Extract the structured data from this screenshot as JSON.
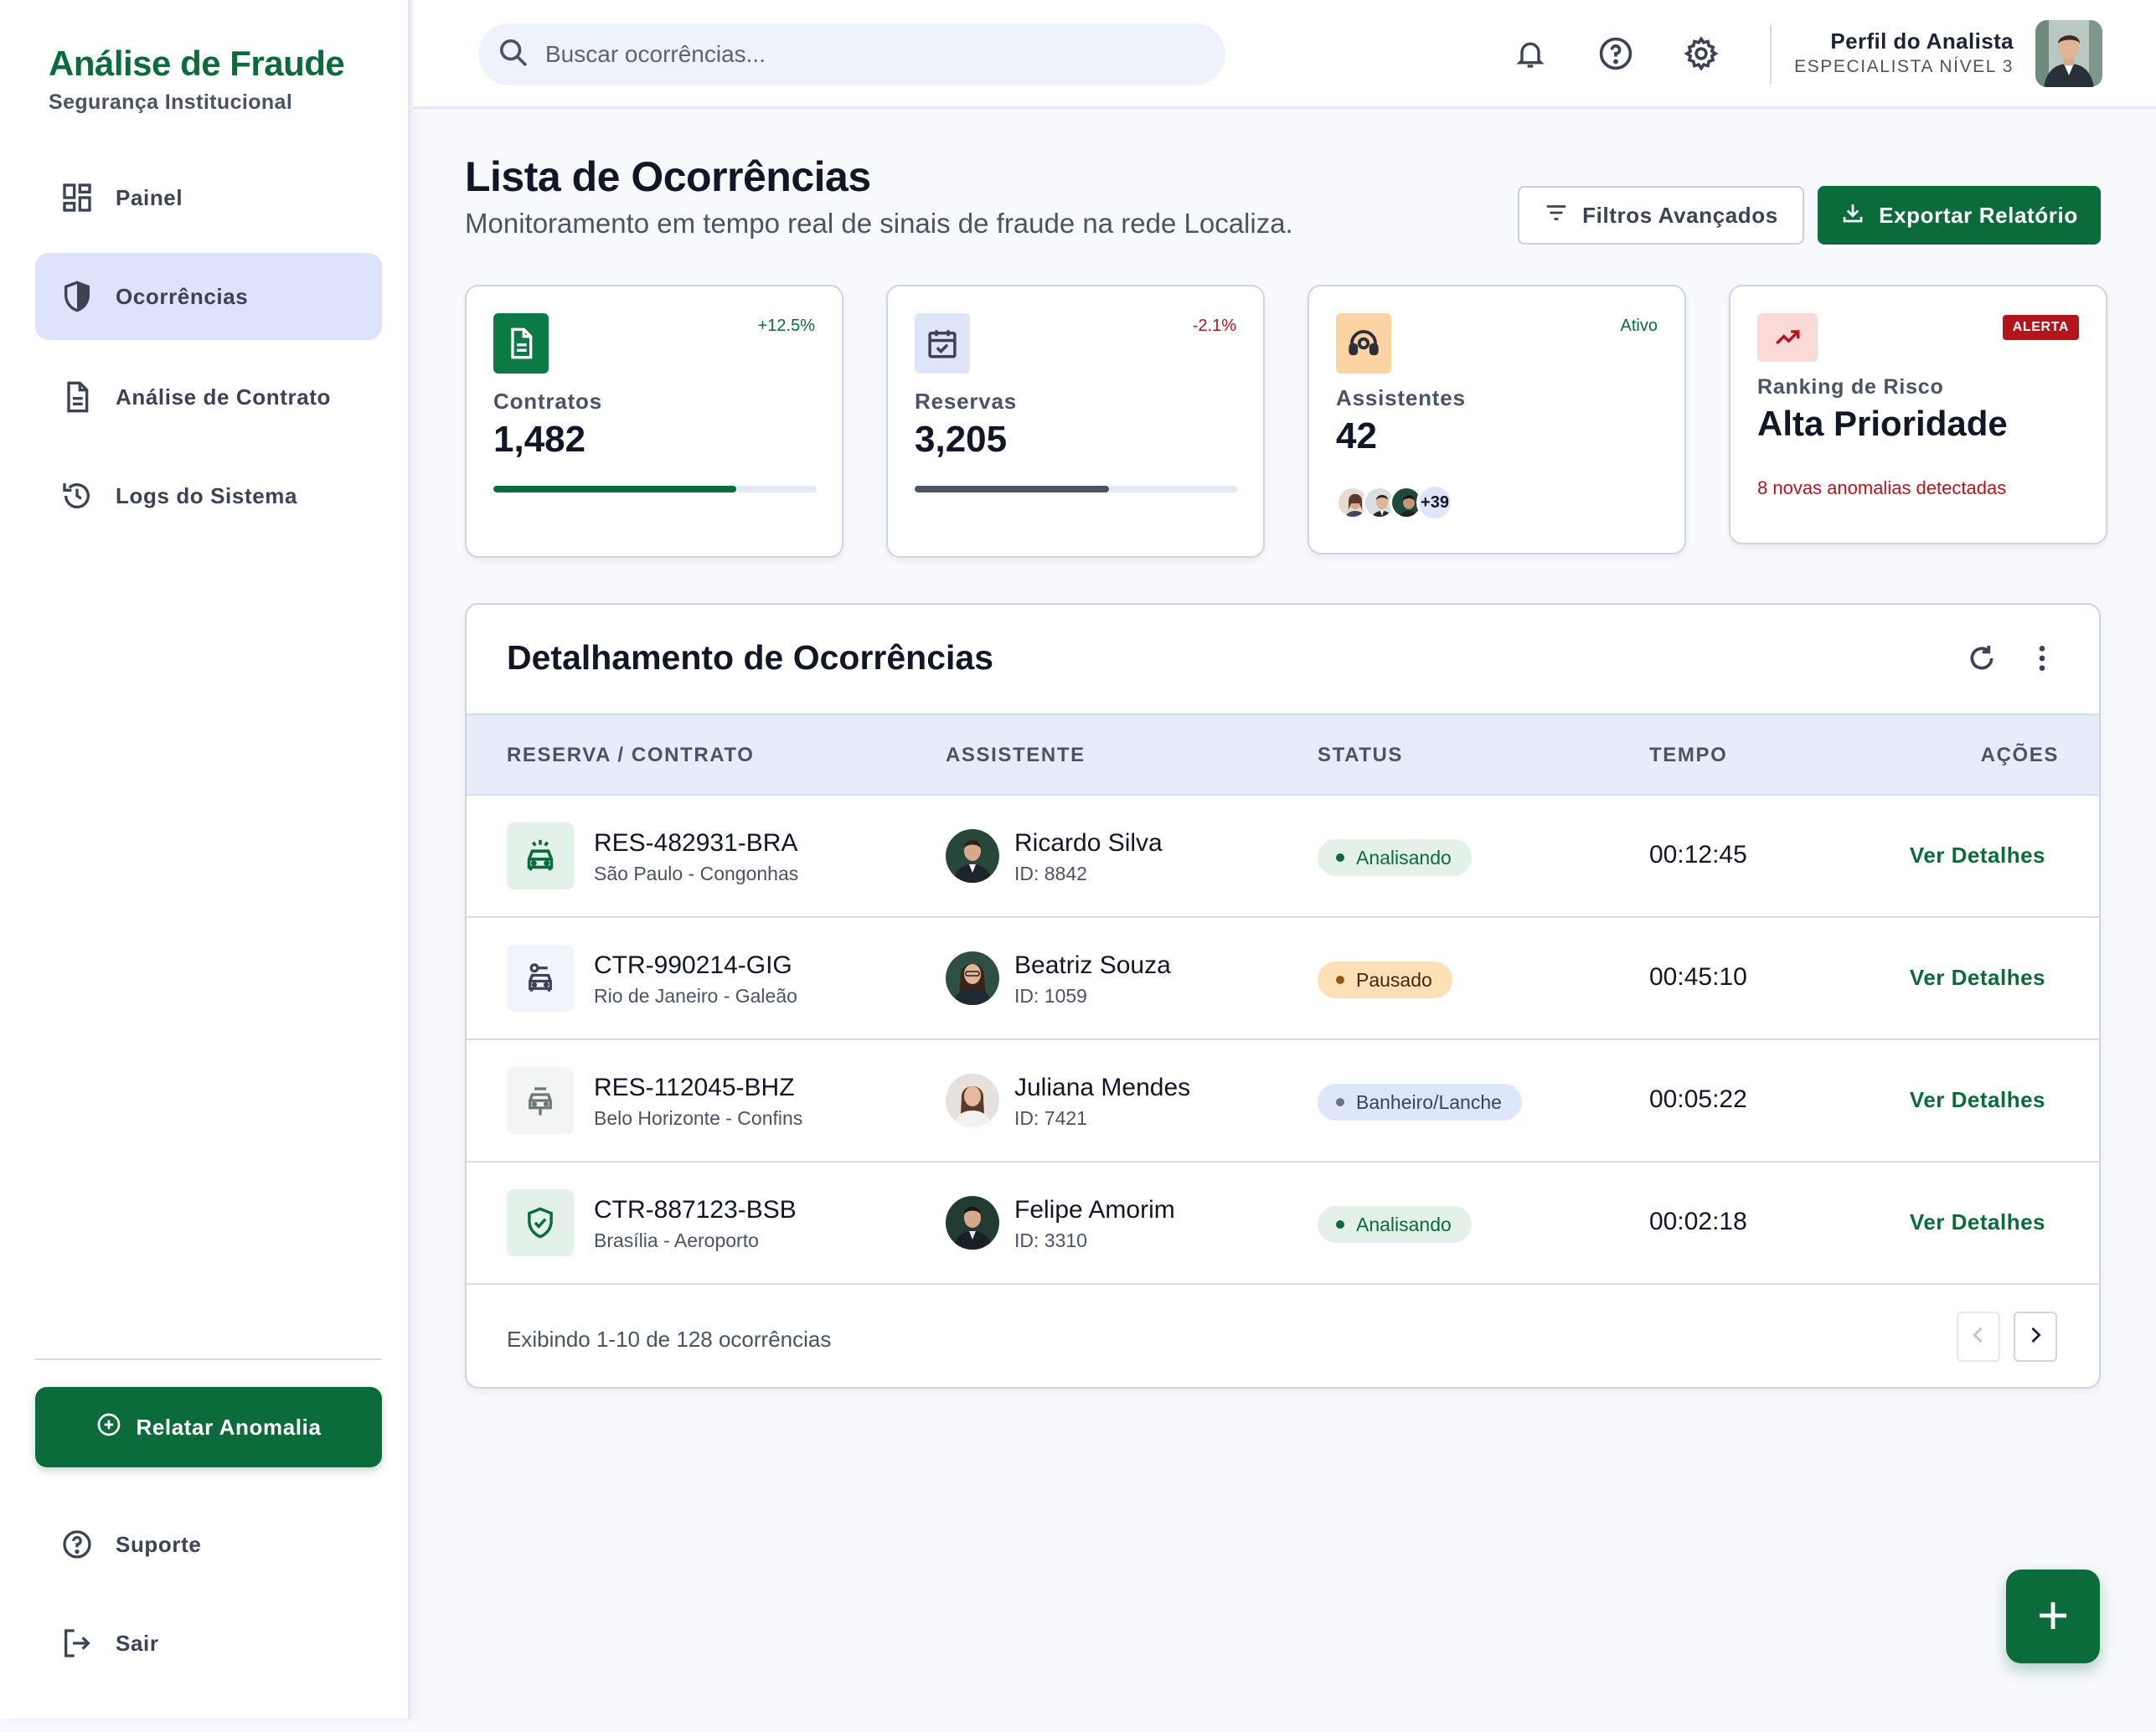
{
  "brand": {
    "title": "Análise de Fraude",
    "subtitle": "Segurança Institucional"
  },
  "sidebar": {
    "items": [
      {
        "label": "Painel",
        "icon": "dashboard-icon",
        "active": false
      },
      {
        "label": "Ocorrências",
        "icon": "shield-icon",
        "active": true
      },
      {
        "label": "Análise de Contrato",
        "icon": "document-icon",
        "active": false
      },
      {
        "label": "Logs do Sistema",
        "icon": "history-icon",
        "active": false
      }
    ],
    "report_button": "Relatar Anomalia",
    "support": "Suporte",
    "logout": "Sair"
  },
  "topbar": {
    "search_placeholder": "Buscar ocorrências...",
    "profile_name": "Perfil do Analista",
    "profile_role": "ESPECIALISTA NÍVEL 3"
  },
  "page": {
    "title": "Lista de Ocorrências",
    "subtitle": "Monitoramento em tempo real de sinais de fraude na rede Localiza.",
    "filters_button": "Filtros Avançados",
    "export_button": "Exportar Relatório"
  },
  "stats": {
    "contracts": {
      "label": "Contratos",
      "value": "1,482",
      "delta": "+12.5%",
      "progress": 0.75
    },
    "reservations": {
      "label": "Reservas",
      "value": "3,205",
      "delta": "-2.1%",
      "progress": 0.6
    },
    "assistants": {
      "label": "Assistentes",
      "value": "42",
      "status": "Ativo",
      "more": "+39"
    },
    "risk": {
      "label": "Ranking de Risco",
      "value": "Alta Prioridade",
      "badge": "ALERTA",
      "note": "8 novas anomalias detectadas"
    }
  },
  "table": {
    "title": "Detalhamento de Ocorrências",
    "headers": [
      "RESERVA / CONTRATO",
      "ASSISTENTE",
      "STATUS",
      "TEMPO",
      "AÇÕES"
    ],
    "rows": [
      {
        "code": "RES-482931-BRA",
        "location": "São Paulo - Congonhas",
        "name": "Ricardo Silva",
        "id": "ID: 8842",
        "status": "Analisando",
        "time": "00:12:45",
        "action": "Ver Detalhes"
      },
      {
        "code": "CTR-990214-GIG",
        "location": "Rio de Janeiro - Galeão",
        "name": "Beatriz Souza",
        "id": "ID: 1059",
        "status": "Pausado",
        "time": "00:45:10",
        "action": "Ver Detalhes"
      },
      {
        "code": "RES-112045-BHZ",
        "location": "Belo Horizonte - Confins",
        "name": "Juliana Mendes",
        "id": "ID: 7421",
        "status": "Banheiro/Lanche",
        "time": "00:05:22",
        "action": "Ver Detalhes"
      },
      {
        "code": "CTR-887123-BSB",
        "location": "Brasília - Aeroporto",
        "name": "Felipe Amorim",
        "id": "ID: 3310",
        "status": "Analisando",
        "time": "00:02:18",
        "action": "Ver Detalhes"
      }
    ],
    "footer": "Exibindo 1-10 de 128 ocorrências"
  },
  "colors": {
    "brand_green": "#0b6b3a",
    "active_nav": "#dde3fb",
    "alert_red": "#b4141c",
    "status_analyzing_bg": "#e4f1e9",
    "status_paused_bg": "#fde0b5",
    "status_break_bg": "#dde6fb"
  }
}
